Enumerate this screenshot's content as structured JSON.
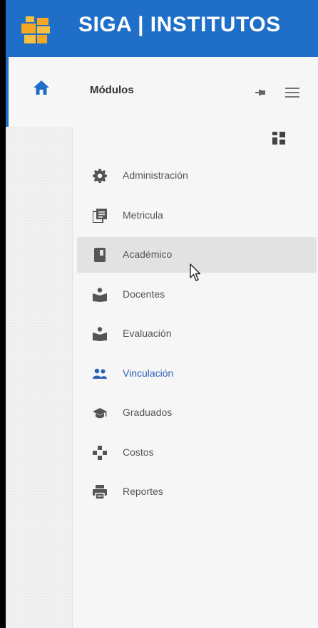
{
  "header": {
    "title": "SIGA | INSTITUTOS",
    "logo_icon": "institution-logo-icon",
    "color": "#1f6fc8"
  },
  "rail": {
    "home_icon": "home-icon"
  },
  "panel": {
    "title": "Módulos",
    "pin_icon": "pin-icon",
    "menu_icon": "hamburger-menu-icon",
    "grid_icon": "grid-view-icon"
  },
  "modules": [
    {
      "label": "Administración",
      "icon": "gear-icon"
    },
    {
      "label": "Metricula",
      "icon": "documents-icon"
    },
    {
      "label": "Académico",
      "icon": "book-icon",
      "state": "hover"
    },
    {
      "label": "Docentes",
      "icon": "teacher-icon"
    },
    {
      "label": "Evaluación",
      "icon": "teacher-icon"
    },
    {
      "label": "Vinculación",
      "icon": "people-icon",
      "color": "#2e62b8"
    },
    {
      "label": "Graduados",
      "icon": "graduation-cap-icon"
    },
    {
      "label": "Costos",
      "icon": "dots-connect-icon"
    },
    {
      "label": "Reportes",
      "icon": "printer-icon"
    }
  ]
}
